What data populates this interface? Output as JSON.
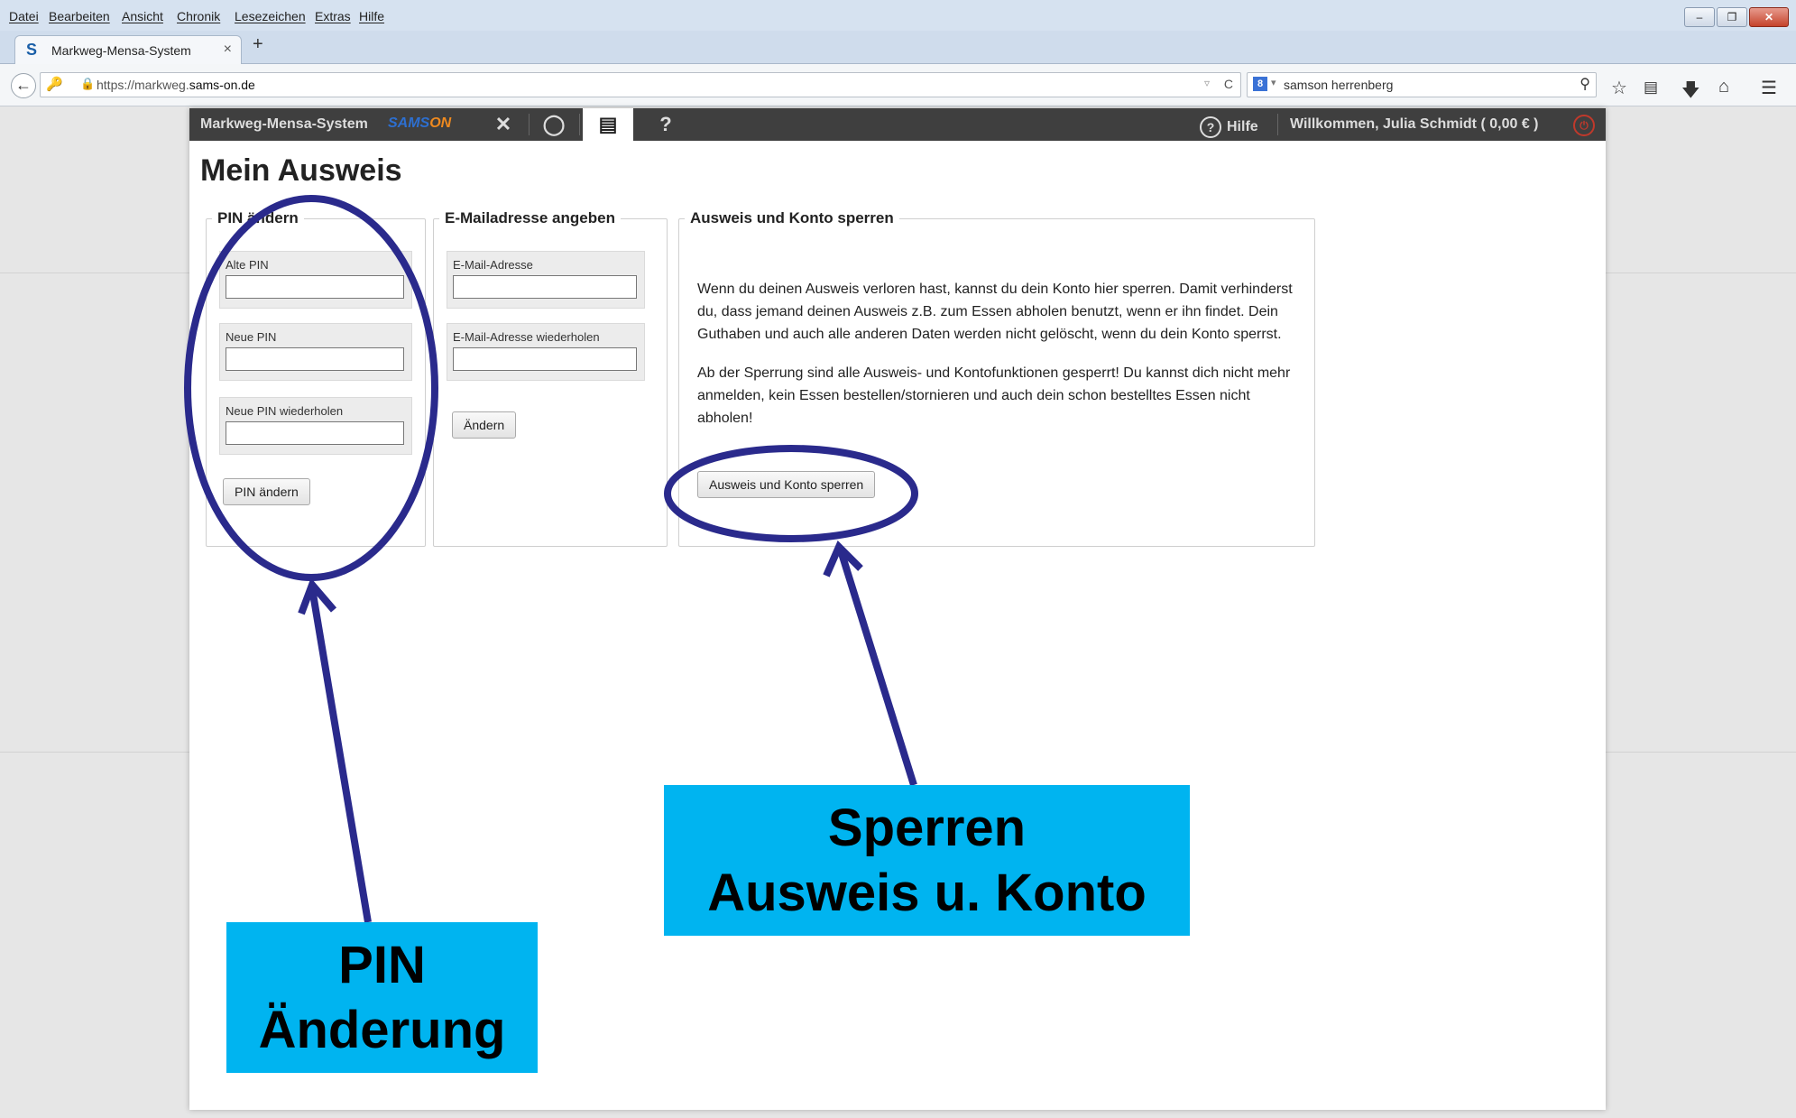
{
  "browser": {
    "menu": [
      "Datei",
      "Bearbeiten",
      "Ansicht",
      "Chronik",
      "Lesezeichen",
      "Extras",
      "Hilfe"
    ],
    "tab_title": "Markweg-Mensa-System",
    "tab_favicon": "S",
    "tab_close": "×",
    "new_tab": "+",
    "url_prefix": "https://markweg.",
    "url_domain": "sams-on.de",
    "search_query": "samson herrenberg",
    "window_buttons": [
      "–",
      "❐",
      "✕"
    ]
  },
  "app": {
    "title": "Markweg-Mensa-System",
    "logo_sams": "SAMS",
    "logo_on": "ON",
    "help_label": "Hilfe",
    "welcome": "Willkommen, Julia Schmidt ( 0,00 € )",
    "icons": [
      "cutlery-icon",
      "piggybank-icon",
      "id-card-icon",
      "help-icon"
    ]
  },
  "page": {
    "title": "Mein Ausweis",
    "pin": {
      "legend": "PIN ändern",
      "old_label": "Alte PIN",
      "new_label": "Neue PIN",
      "repeat_label": "Neue PIN wiederholen",
      "button": "PIN ändern"
    },
    "email": {
      "legend": "E-Mailadresse angeben",
      "address_label": "E-Mail-Adresse",
      "repeat_label": "E-Mail-Adresse wiederholen",
      "button": "Ändern"
    },
    "lock": {
      "legend": "Ausweis und Konto sperren",
      "text1": "Wenn du deinen Ausweis verloren hast, kannst du dein Konto hier sperren. Damit verhinderst du, dass jemand deinen Ausweis z.B. zum Essen abholen benutzt, wenn er ihn findet. Dein Guthaben und auch alle anderen Daten werden nicht gelöscht, wenn du dein Konto sperrst.",
      "text2": "Ab der Sperrung sind alle Ausweis- und Kontofunktionen gesperrt! Du kannst dich nicht mehr anmelden, kein Essen bestellen/stornieren und auch dein schon bestelltes Essen nicht abholen!",
      "button": "Ausweis und Konto sperren"
    }
  },
  "annotations": {
    "pin_callout_line1": "PIN",
    "pin_callout_line2": "Änderung",
    "lock_callout_line1": "Sperren",
    "lock_callout_line2": "Ausweis u. Konto",
    "color": "#2a2a8c",
    "callout_bg": "#00b4f0"
  }
}
